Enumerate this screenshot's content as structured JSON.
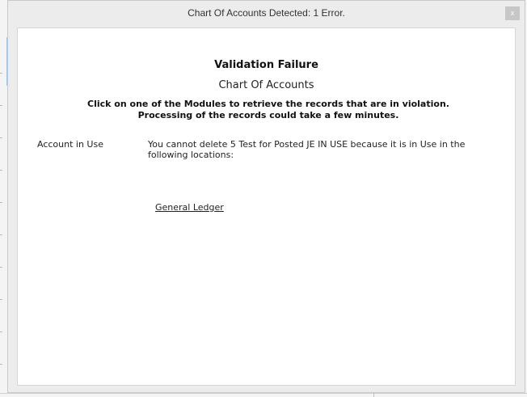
{
  "window": {
    "title": "Chart Of Accounts Detected: 1 Error.",
    "close_label": "x"
  },
  "validation": {
    "heading": "Validation Failure",
    "subheading": "Chart Of Accounts",
    "instruction": "Click on one of the Modules to retrieve the records that are in violation. Processing of the records could take a few minutes."
  },
  "errors": [
    {
      "label": "Account in Use",
      "message": "You cannot delete 5 Test for Posted JE IN USE because it is in Use in the following locations:",
      "modules": [
        "General Ledger"
      ]
    }
  ]
}
